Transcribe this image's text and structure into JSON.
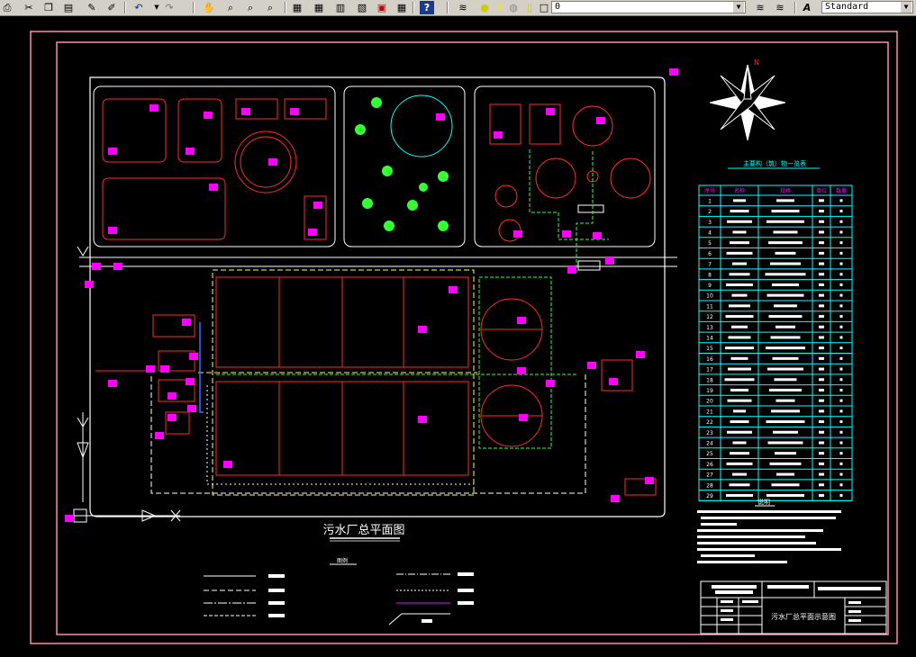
{
  "toolbar": {
    "layer_value": "0",
    "textstyle_value": "Standard",
    "icons": [
      "layer-manager-icon",
      "bulb-icon",
      "sun-icon",
      "freeze-icon",
      "lock-icon",
      "color-square-icon"
    ]
  },
  "drawing": {
    "title": "污水厂总平面图",
    "legend_title": "图例",
    "table_title": "主要构（筑）物一览表",
    "notes_title": "说明",
    "titleblock_name": "污水厂总平面示意图",
    "north": "N",
    "table_headers": [
      "序号",
      "名称",
      "规格",
      "单位",
      "数量"
    ],
    "row_numbers": [
      "1",
      "2",
      "3",
      "4",
      "5",
      "6",
      "7",
      "8",
      "9",
      "10",
      "11",
      "12",
      "13",
      "14",
      "15",
      "16",
      "17",
      "18",
      "19",
      "20",
      "21",
      "22",
      "23",
      "24",
      "25",
      "26",
      "27",
      "28",
      "29"
    ]
  },
  "colors": {
    "frame": "#ff8ab0",
    "wall": "#ffffff",
    "building": "#ff2a2a",
    "pipe_green": "#33ff33",
    "pipe_yellow": "#ffff55",
    "magenta": "#ff00ff",
    "cyan": "#00ffff",
    "tree": "#33ff33"
  }
}
